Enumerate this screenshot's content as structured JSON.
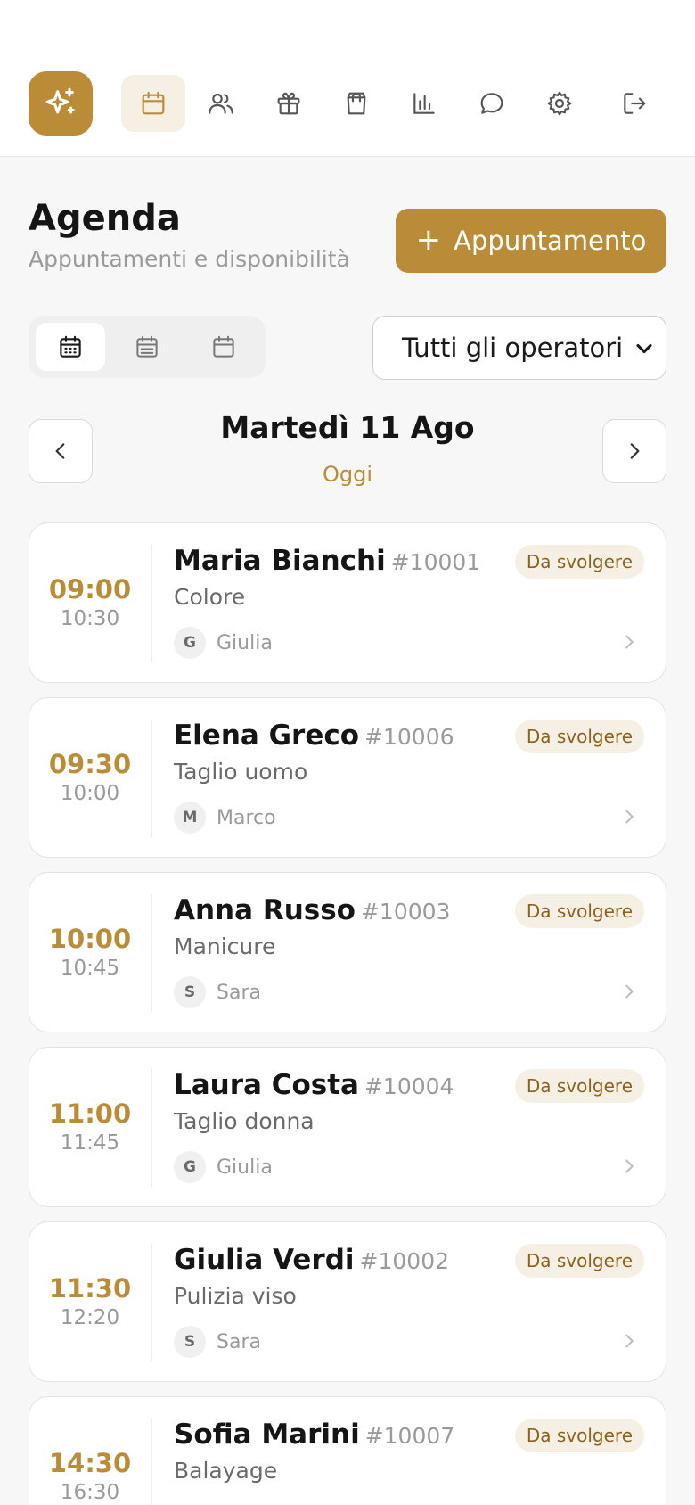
{
  "app": {
    "logo_icon": "sparkles-icon",
    "nav": [
      {
        "icon": "calendar-icon",
        "active": true
      },
      {
        "icon": "users-icon",
        "active": false
      },
      {
        "icon": "gift-icon",
        "active": false
      },
      {
        "icon": "shopping-bag-icon",
        "active": false
      },
      {
        "icon": "bar-chart-icon",
        "active": false
      },
      {
        "icon": "chat-icon",
        "active": false
      },
      {
        "icon": "settings-icon",
        "active": false
      },
      {
        "icon": "logout-icon",
        "active": false
      }
    ],
    "accent_color": "#bb8c37"
  },
  "header": {
    "title": "Agenda",
    "subtitle": "Appuntamenti e disponibilità",
    "add_button_label": "Appuntamento",
    "add_button_icon": "plus-icon"
  },
  "filters": {
    "views": [
      {
        "icon": "calendar-day-icon",
        "active": true
      },
      {
        "icon": "calendar-week-icon",
        "active": false
      },
      {
        "icon": "calendar-month-icon",
        "active": false
      }
    ],
    "operator_select": {
      "value": "Tutti gli operatori"
    }
  },
  "date_nav": {
    "date": "Martedì 11 Ago",
    "today_label": "Oggi",
    "prev_icon": "chevron-left-icon",
    "next_icon": "chevron-right-icon"
  },
  "appointments": [
    {
      "start": "09:00",
      "end": "10:30",
      "client": "Maria Bianchi",
      "code": "#10001",
      "service": "Colore",
      "operator_initial": "G",
      "operator": "Giulia",
      "status": "Da svolgere"
    },
    {
      "start": "09:30",
      "end": "10:00",
      "client": "Elena Greco",
      "code": "#10006",
      "service": "Taglio uomo",
      "operator_initial": "M",
      "operator": "Marco",
      "status": "Da svolgere"
    },
    {
      "start": "10:00",
      "end": "10:45",
      "client": "Anna Russo",
      "code": "#10003",
      "service": "Manicure",
      "operator_initial": "S",
      "operator": "Sara",
      "status": "Da svolgere"
    },
    {
      "start": "11:00",
      "end": "11:45",
      "client": "Laura Costa",
      "code": "#10004",
      "service": "Taglio donna",
      "operator_initial": "G",
      "operator": "Giulia",
      "status": "Da svolgere"
    },
    {
      "start": "11:30",
      "end": "12:20",
      "client": "Giulia Verdi",
      "code": "#10002",
      "service": "Pulizia viso",
      "operator_initial": "S",
      "operator": "Sara",
      "status": "Da svolgere"
    },
    {
      "start": "14:30",
      "end": "16:30",
      "client": "Sofia Marini",
      "code": "#10007",
      "service": "Balayage",
      "operator_initial": "",
      "operator": "",
      "status": "Da svolgere"
    }
  ]
}
